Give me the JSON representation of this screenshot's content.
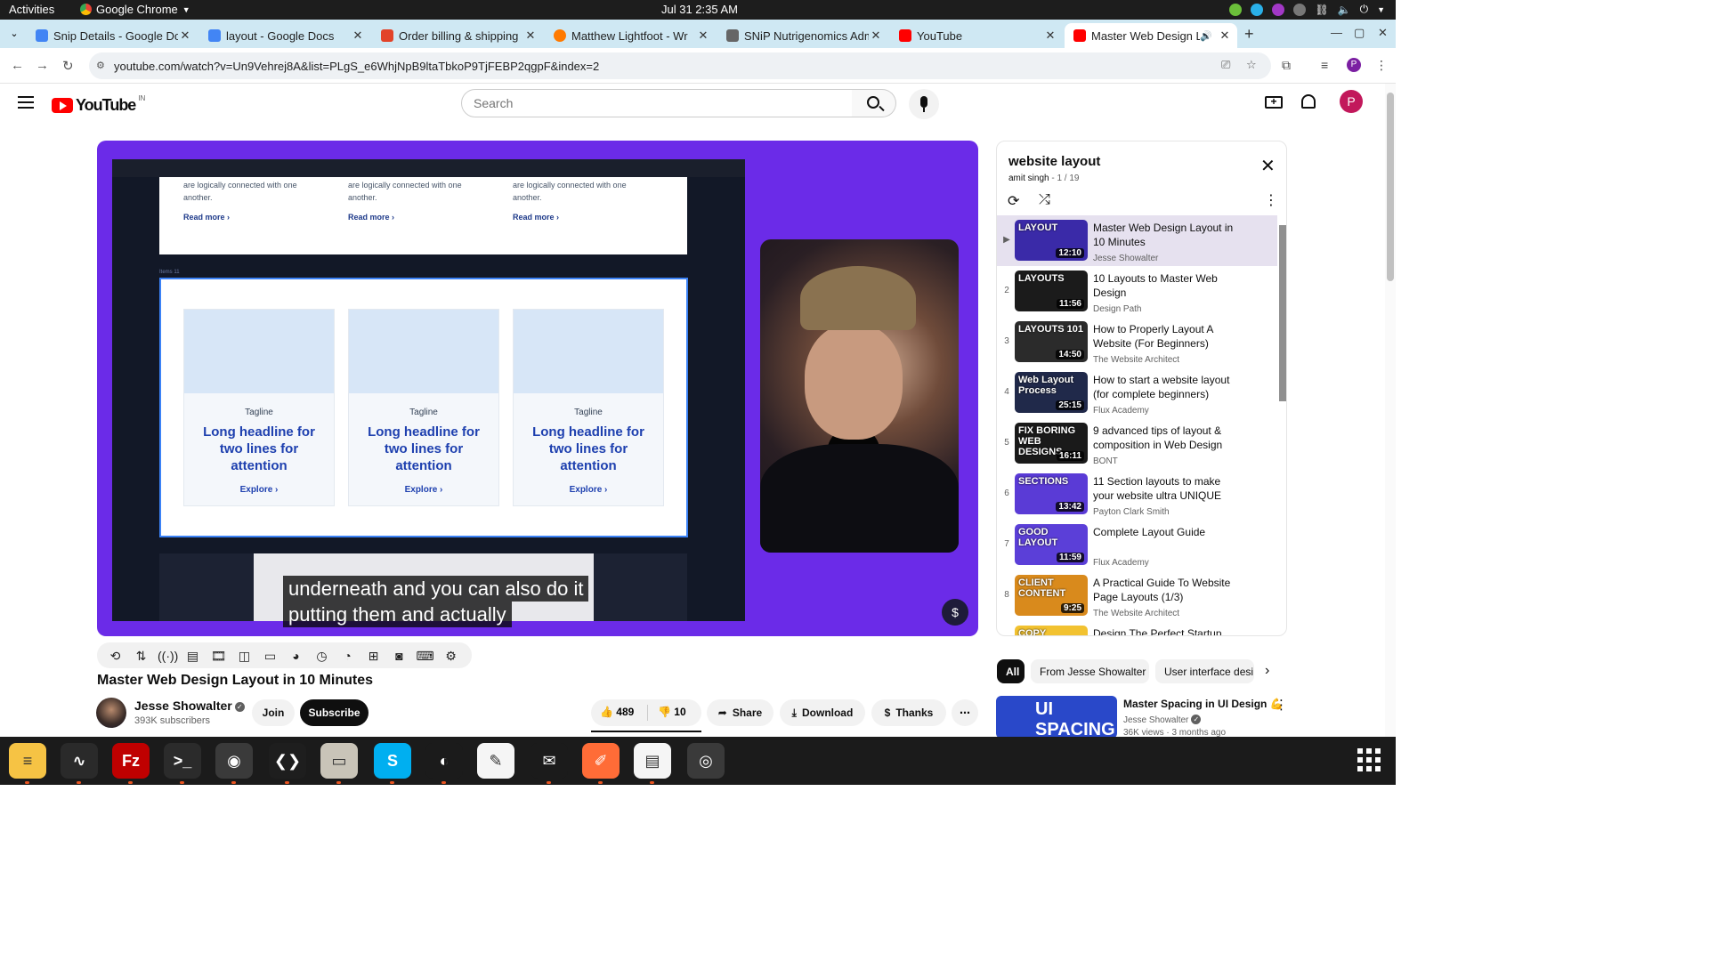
{
  "system": {
    "activities": "Activities",
    "app": "Google Chrome",
    "clock": "Jul 31  2:35 AM"
  },
  "tabs": [
    {
      "title": "Snip Details - Google Do",
      "color": "#4285f4"
    },
    {
      "title": "layout - Google Docs",
      "color": "#4285f4"
    },
    {
      "title": "Order billing & shipping",
      "color": "#e24329"
    },
    {
      "title": "Matthew Lightfoot - Wr",
      "color": "#ff7a00"
    },
    {
      "title": "SNiP Nutrigenomics Adm",
      "color": "#666666"
    },
    {
      "title": "YouTube",
      "color": "#ff0000"
    },
    {
      "title": "Master Web Design L",
      "color": "#ff0000"
    }
  ],
  "addressbar": {
    "url": "youtube.com/watch?v=Un9Vehrej8A&list=PLgS_e6WhjNpB9ltaTbkoP9TjFEBP2qgpF&index=2"
  },
  "youtube": {
    "logo": "YouTube",
    "country": "IN",
    "search_placeholder": "Search",
    "avatar": "P"
  },
  "video": {
    "panel_text": "are logically connected with one another.",
    "read_more": "Read more ›",
    "items_label": "Items 11",
    "cards": [
      {
        "tagline": "Tagline",
        "headline": "Long headline for two lines for attention",
        "cta": "Explore ›"
      },
      {
        "tagline": "Tagline",
        "headline": "Long headline for two lines for attention",
        "cta": "Explore ›"
      },
      {
        "tagline": "Tagline",
        "headline": "Long headline for two lines for attention",
        "cta": "Explore ›"
      }
    ],
    "caption_line1": "underneath and you can also do it",
    "caption_line2": "putting them and actually",
    "title": "Master Web Design Layout in 10 Minutes",
    "channel": "Jesse Showalter",
    "subscribers": "393K subscribers",
    "join": "Join",
    "subscribe": "Subscribe",
    "likes": "489",
    "dislikes": "10",
    "share": "Share",
    "download": "Download",
    "thanks": "Thanks"
  },
  "playlist": {
    "title": "website layout",
    "owner": "amit singh",
    "position": "1 / 19",
    "items": [
      {
        "idx": "▶",
        "title": "Master Web Design Layout in 10 Minutes",
        "channel": "Jesse Showalter",
        "duration": "12:10",
        "thumb_text": "LAYOUT",
        "thumb_color": "#3a2aa8"
      },
      {
        "idx": "2",
        "title": "10 Layouts to Master Web Design",
        "channel": "Design Path",
        "duration": "11:56",
        "thumb_text": "LAYOUTS",
        "thumb_color": "#1b1b1b"
      },
      {
        "idx": "3",
        "title": "How to Properly Layout A Website (For Beginners)",
        "channel": "The Website Architect",
        "duration": "14:50",
        "thumb_text": "LAYOUTS 101",
        "thumb_color": "#2b2b2b"
      },
      {
        "idx": "4",
        "title": "How to start a website layout (for complete beginners)",
        "channel": "Flux Academy",
        "duration": "25:15",
        "thumb_text": "Web Layout Process",
        "thumb_color": "#20294a"
      },
      {
        "idx": "5",
        "title": "9 advanced tips of layout & composition in Web Design",
        "channel": "BONT",
        "duration": "16:11",
        "thumb_text": "FIX BORING WEB DESIGNS",
        "thumb_color": "#1a1a1a"
      },
      {
        "idx": "6",
        "title": "11 Section layouts to make your website ultra UNIQUE",
        "channel": "Payton Clark Smith",
        "duration": "13:42",
        "thumb_text": "SECTIONS",
        "thumb_color": "#5a3bd6"
      },
      {
        "idx": "7",
        "title": "Complete Layout Guide",
        "channel": "Flux Academy",
        "duration": "11:59",
        "thumb_text": "GOOD LAYOUT",
        "thumb_color": "#5b3fd8"
      },
      {
        "idx": "8",
        "title": "A Practical Guide To Website Page Layouts (1/3)",
        "channel": "The Website Architect",
        "duration": "9:25",
        "thumb_text": "CLIENT CONTENT",
        "thumb_color": "#d98a1c"
      },
      {
        "idx": "9",
        "title": "Design The Perfect Startup",
        "channel": "",
        "duration": "",
        "thumb_text": "COPY",
        "thumb_color": "#f2c230"
      }
    ]
  },
  "chips": [
    "All",
    "From Jesse Showalter",
    "User interface desi"
  ],
  "recommendation": {
    "title": "Master Spacing in UI Design 💪",
    "channel": "Jesse Showalter",
    "views": "36K views · 3 months ago",
    "thumb_text": "UI SPACING"
  },
  "dock": [
    {
      "name": "notes",
      "color": "#f6c344",
      "glyph": "≡"
    },
    {
      "name": "system-monitor",
      "color": "#2a2a2a",
      "glyph": "∿"
    },
    {
      "name": "filezilla",
      "color": "#bf0000",
      "glyph": "Fz"
    },
    {
      "name": "terminal",
      "color": "#2b2b2b",
      "glyph": ">_"
    },
    {
      "name": "chrome",
      "color": "#3a3a3a",
      "glyph": "◉"
    },
    {
      "name": "vscode",
      "color": "#1e1e1e",
      "glyph": "❮❯"
    },
    {
      "name": "files",
      "color": "#c9c4b8",
      "glyph": "▭"
    },
    {
      "name": "skype",
      "color": "#00aff0",
      "glyph": "S"
    },
    {
      "name": "blender",
      "color": "#1b1b1b",
      "glyph": "◐"
    },
    {
      "name": "text-editor",
      "color": "#f5f5f5",
      "glyph": "✎"
    },
    {
      "name": "thunderbird",
      "color": "#1b1b1b",
      "glyph": "✉"
    },
    {
      "name": "postman",
      "color": "#ff6c37",
      "glyph": "✐"
    },
    {
      "name": "libreoffice-writer",
      "color": "#f5f5f5",
      "glyph": "▤"
    },
    {
      "name": "disks",
      "color": "#3a3a3a",
      "glyph": "◎"
    }
  ]
}
